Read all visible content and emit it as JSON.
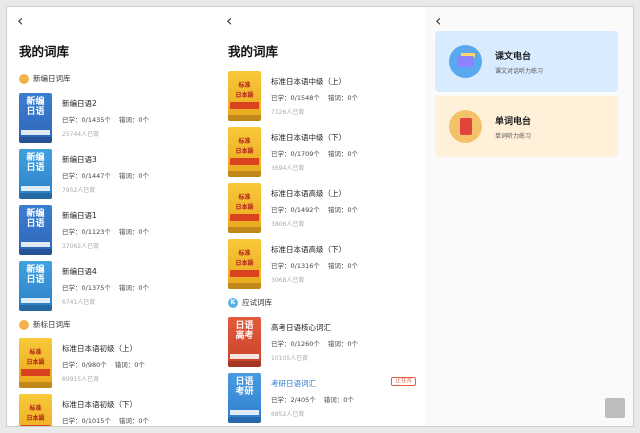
{
  "nav": {
    "back_glyph": "‹"
  },
  "panel1": {
    "title": "我的词库",
    "sections": [
      {
        "label": "新编日词库",
        "icon": "book-icon"
      },
      {
        "label": "新标日词库",
        "icon": "book-icon"
      }
    ],
    "books": [
      {
        "name": "新编日语2",
        "cover": [
          "新编",
          "日语"
        ],
        "learned": "已学：0/1435个",
        "wrong": "错词：0个",
        "count": "25744人已背"
      },
      {
        "name": "新编日语3",
        "cover": [
          "新编",
          "日语"
        ],
        "learned": "已学：0/1447个",
        "wrong": "错词：0个",
        "count": "7952人已背"
      },
      {
        "name": "新编日语1",
        "cover": [
          "新编",
          "日语"
        ],
        "learned": "已学：0/1123个",
        "wrong": "错词：0个",
        "count": "37062人已背"
      },
      {
        "name": "新编日语4",
        "cover": [
          "新编",
          "日语"
        ],
        "learned": "已学：0/1375个",
        "wrong": "错词：0个",
        "count": "6741人已背"
      },
      {
        "name": "标准日本语初级（上）",
        "cover": [
          "标准",
          "日本語"
        ],
        "learned": "已学：0/980个",
        "wrong": "错词：0个",
        "count": "89915人已背"
      },
      {
        "name": "标准日本语初级（下）",
        "cover": [
          "标准",
          "日本語"
        ],
        "learned": "已学：0/1015个",
        "wrong": "错词：0个",
        "count": ""
      }
    ]
  },
  "panel2": {
    "title": "我的词库",
    "sections": [
      {
        "label": "应试词库",
        "icon": "k-icon"
      }
    ],
    "books": [
      {
        "name": "标准日本语中级（上）",
        "cover": [
          "标准",
          "日本語"
        ],
        "learned": "已学：0/1548个",
        "wrong": "错词：0个",
        "count": "7126人已背"
      },
      {
        "name": "标准日本语中级（下）",
        "cover": [
          "标准",
          "日本語"
        ],
        "learned": "已学：0/1709个",
        "wrong": "错词：0个",
        "count": "3694人已背"
      },
      {
        "name": "标准日本语高级（上）",
        "cover": [
          "标准",
          "日本語"
        ],
        "learned": "已学：0/1492个",
        "wrong": "错词：0个",
        "count": "3806人已背"
      },
      {
        "name": "标准日本语高级（下）",
        "cover": [
          "标准",
          "日本語"
        ],
        "learned": "已学：0/1316个",
        "wrong": "错词：0个",
        "count": "3068人已背"
      },
      {
        "name": "高考日语核心词汇",
        "cover": [
          "日语",
          "高考"
        ],
        "learned": "已学：0/1260个",
        "wrong": "错词：0个",
        "count": "10105人已背"
      },
      {
        "name": "考研日语词汇",
        "cover": [
          "日语",
          "考研"
        ],
        "learned": "已学：2/405个",
        "wrong": "错词：0个",
        "count": "6852人已背",
        "tag": "正在背"
      }
    ]
  },
  "panel3": {
    "cards": [
      {
        "title": "课文电台",
        "sub": "课文对话听力练习"
      },
      {
        "title": "单词电台",
        "sub": "单词听力练习"
      }
    ]
  },
  "colors": {
    "accent": "#2e7ed0",
    "card1_bg": "#d9ebff",
    "card2_bg": "#fff0d9",
    "tag": "#e35b3e"
  }
}
